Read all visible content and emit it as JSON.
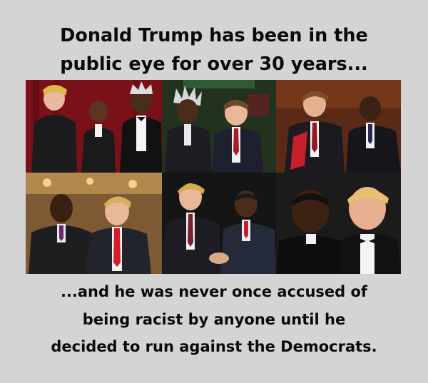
{
  "headline_top": {
    "line1": "Donald Trump has been in the",
    "line2": "public eye for over 30 years..."
  },
  "headline_bottom": {
    "line1": "...and he was never once accused of",
    "line2": "being racist by anyone until he",
    "line3": "decided to run against the Democrats."
  },
  "colors": {
    "background": "#d4d4d4",
    "text": "#0a0a0a"
  }
}
